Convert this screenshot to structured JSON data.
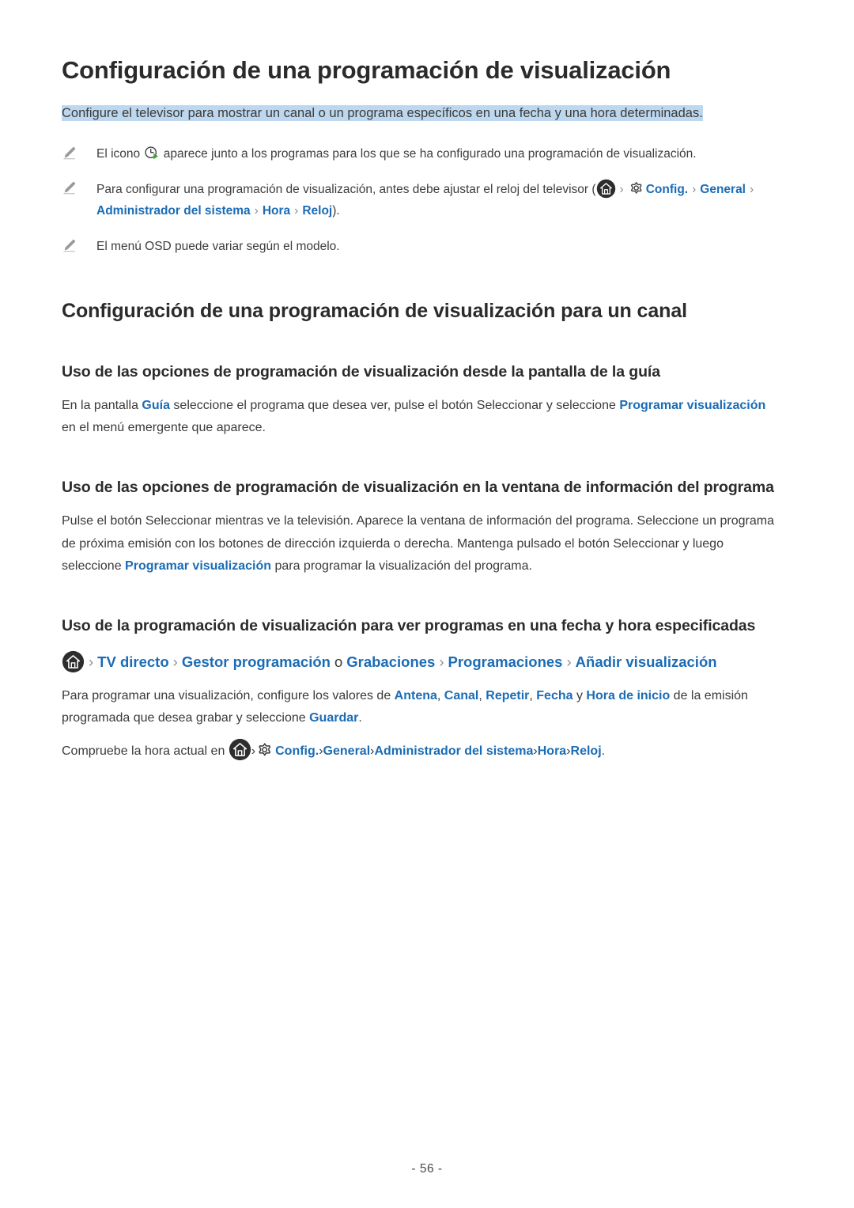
{
  "document": {
    "title": "Configuración de una programación de visualización",
    "subtitle": "Configure el televisor para mostrar un canal o un programa específicos en una fecha y una hora determinadas.",
    "page_number": "- 56 -"
  },
  "colors": {
    "link_blue": "#1b6cb5",
    "highlight": "#bdd7ee",
    "text": "#3a3a3a",
    "icon_dark": "#2d2d2d",
    "play_green": "#3fa535"
  },
  "notes": [
    {
      "bullet_icon": "pencil-icon",
      "parts": [
        {
          "type": "text",
          "value": "El icono "
        },
        {
          "type": "icon",
          "value": "schedule-view-clock-icon"
        },
        {
          "type": "text",
          "value": " aparece junto a los programas para los que se ha configurado una programación de visualización."
        }
      ]
    },
    {
      "bullet_icon": "pencil-icon",
      "parts": [
        {
          "type": "text",
          "value": "Para configurar una programación de visualización, antes debe ajustar el reloj del televisor ("
        },
        {
          "type": "icon",
          "value": "home-icon"
        },
        {
          "type": "sep",
          "value": "›"
        },
        {
          "type": "icon",
          "value": "gear-icon"
        },
        {
          "type": "link",
          "value": "Config."
        },
        {
          "type": "sep",
          "value": "›"
        },
        {
          "type": "link",
          "value": "General"
        },
        {
          "type": "sep",
          "value": "›"
        },
        {
          "type": "link",
          "value": "Administrador del sistema"
        },
        {
          "type": "sep",
          "value": "›"
        },
        {
          "type": "link",
          "value": "Hora"
        },
        {
          "type": "sep",
          "value": "›"
        },
        {
          "type": "link",
          "value": "Reloj"
        },
        {
          "type": "text",
          "value": ")."
        }
      ]
    },
    {
      "bullet_icon": "pencil-icon",
      "parts": [
        {
          "type": "text",
          "value": "El menú OSD puede variar según el modelo."
        }
      ]
    }
  ],
  "sections": [
    {
      "heading": "Configuración de una programación de visualización para un canal",
      "subsections": [
        {
          "heading": "Uso de las opciones de programación de visualización desde la pantalla de la guía",
          "paragraph": {
            "p1": "En la pantalla ",
            "l1": "Guía",
            "p2": " seleccione el programa que desea ver, pulse el botón Seleccionar y seleccione ",
            "l2": "Programar visualización",
            "p3": " en el menú emergente que aparece."
          }
        },
        {
          "heading": "Uso de las opciones de programación de visualización en la ventana de información del programa",
          "paragraph": {
            "p1": "Pulse el botón Seleccionar mientras ve la televisión. Aparece la ventana de información del programa. Seleccione un programa de próxima emisión con los botones de dirección izquierda o derecha. Mantenga pulsado el botón Seleccionar y luego seleccione ",
            "l2": "Programar visualización",
            "p3": " para programar la visualización del programa."
          }
        },
        {
          "heading": "Uso de la programación de visualización para ver programas en una fecha y hora especificadas",
          "menu_path": {
            "home_icon": "home-icon",
            "items": [
              {
                "label": "TV directo",
                "kind": "link"
              },
              {
                "label": "Gestor programación",
                "kind": "link"
              },
              {
                "label": "o",
                "kind": "plain"
              },
              {
                "label": "Grabaciones",
                "kind": "link"
              },
              {
                "label": "Programaciones",
                "kind": "link"
              },
              {
                "label": "Añadir visualización",
                "kind": "link"
              }
            ]
          },
          "paragraph2": {
            "p1": "Para programar una visualización, configure los valores de ",
            "l1": "Antena",
            "s1": ", ",
            "l2": "Canal",
            "s2": ", ",
            "l3": "Repetir",
            "s3": ", ",
            "l4": "Fecha",
            "s4": " y ",
            "l5": "Hora de inicio",
            "p2": " de la emisión programada que desea grabar y seleccione ",
            "l6": "Guardar",
            "p3": "."
          },
          "check_time": {
            "prefix": "Compruebe la hora actual en ",
            "home_icon": "home-icon",
            "gear_icon": "gear-icon",
            "items": [
              "Config.",
              "General",
              "Administrador del sistema",
              "Hora",
              "Reloj"
            ],
            "suffix": "."
          }
        }
      ]
    }
  ]
}
